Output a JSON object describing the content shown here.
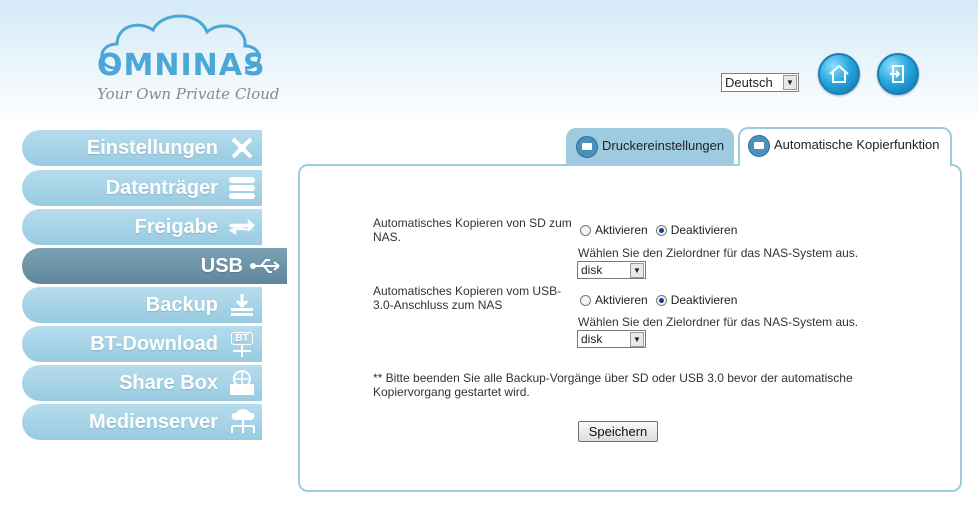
{
  "logo": {
    "name": "OMNINAS",
    "tagline": "Your Own Private Cloud"
  },
  "header": {
    "language": "Deutsch",
    "home_icon": "home-icon",
    "logout_icon": "logout-icon"
  },
  "sidebar": {
    "items": [
      {
        "label": "Einstellungen",
        "icon": "tools-icon"
      },
      {
        "label": "Datenträger",
        "icon": "disk-stack-icon"
      },
      {
        "label": "Freigabe",
        "icon": "share-arrows-icon"
      },
      {
        "label": "USB",
        "icon": "usb-icon"
      },
      {
        "label": "Backup",
        "icon": "backup-icon"
      },
      {
        "label": "BT-Download",
        "icon": "bt-icon",
        "badge": "BT"
      },
      {
        "label": "Share Box",
        "icon": "sharebox-icon"
      },
      {
        "label": "Medienserver",
        "icon": "media-server-icon"
      }
    ],
    "active": "USB"
  },
  "tabs": [
    {
      "label": "Druckereinstellungen",
      "active": false
    },
    {
      "label": "Automatische Kopierfunktion",
      "active": true
    }
  ],
  "form": {
    "sd": {
      "label": "Automatisches Kopieren von SD zum NAS.",
      "enable": "Aktivieren",
      "disable": "Deaktivieren",
      "selected": "Deaktivieren",
      "hint": "Wählen Sie den Zielordner für das NAS-System aus.",
      "folder": "disk"
    },
    "usb": {
      "label": "Automatisches Kopieren vom USB-3.0-Anschluss zum NAS",
      "enable": "Aktivieren",
      "disable": "Deaktivieren",
      "selected": "Deaktivieren",
      "hint": "Wählen Sie den Zielordner für das NAS-System aus.",
      "folder": "disk"
    },
    "note": "** Bitte beenden Sie alle Backup-Vorgänge über SD oder USB 3.0 bevor der automatische Kopiervorgang gestartet wird.",
    "save_label": "Speichern"
  },
  "colors": {
    "accent": "#9fcbe0",
    "nav": "#98cbe1",
    "nav_active": "#6a91a5",
    "logo_blue": "#4aa8d8"
  }
}
